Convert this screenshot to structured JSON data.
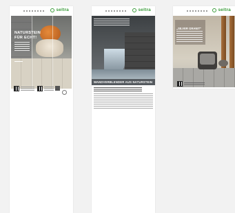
{
  "documents": [
    {
      "brand": "seltra",
      "hero_title_line1": "NATURSTEIN",
      "hero_title_line2": "FÜR ECHT!"
    },
    {
      "brand": "seltra",
      "section_heading": "WANDVERBLENDER AUS NATURSTEIN"
    },
    {
      "brand": "seltra",
      "hero_title": "„SILVER GRANIT\""
    }
  ],
  "colors": {
    "brand_green": "#3a9b3a",
    "page_background": "#f2f2f2"
  }
}
